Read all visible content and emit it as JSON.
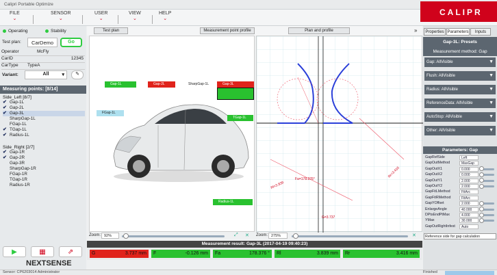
{
  "window": {
    "title": "Calipri Portable Optimize"
  },
  "menu": {
    "items": [
      "FILE",
      "SENSOR",
      "USER",
      "VIEW",
      "HELP"
    ]
  },
  "brand": {
    "name": "CALIPR"
  },
  "status": {
    "operating": "Operating",
    "stability": "Stability"
  },
  "testplan": {
    "label": "Test plan:",
    "value": "CarDemo",
    "button": "Go"
  },
  "fields": [
    {
      "label": "Operator",
      "value": "McFly"
    },
    {
      "label": "CarID",
      "value": "12345"
    },
    {
      "label": "CarType",
      "value": "TypeA"
    }
  ],
  "variant": {
    "label": "Variant:",
    "value": "All"
  },
  "measuring_points": {
    "title": "Measuring points: [8/14]"
  },
  "tree": {
    "side_left": {
      "label": "Side_Left [8/7]",
      "items": [
        {
          "label": "Gap-1L",
          "checked": true
        },
        {
          "label": "Gap-2L",
          "checked": true
        },
        {
          "label": "Gap-3L",
          "checked": true
        },
        {
          "label": "SharpGap-1L",
          "checked": false
        },
        {
          "label": "FGap-1L",
          "checked": false
        },
        {
          "label": "TGap-1L",
          "checked": true
        },
        {
          "label": "Radius-1L",
          "checked": true
        }
      ]
    },
    "side_right": {
      "label": "Side_Right [2/7]",
      "items": [
        {
          "label": "Gap-1R",
          "checked": true
        },
        {
          "label": "Gap-2R",
          "checked": true
        },
        {
          "label": "Gap-3R",
          "checked": false
        },
        {
          "label": "SharpGap-1R",
          "checked": false
        },
        {
          "label": "FGap-1R",
          "checked": false
        },
        {
          "label": "TGap-1R",
          "checked": false
        },
        {
          "label": "Radius-1R",
          "checked": false
        }
      ]
    }
  },
  "footer_brand": "NEXTSENSE",
  "center_tabs": {
    "test_plan": "Test plan",
    "mpp": "Measurement point profile",
    "plan_profile": "Plan and profile"
  },
  "zoom": {
    "label": "Zoom:",
    "left_value": "92%",
    "right_value": "275%"
  },
  "result": {
    "title": "Measurement result: Gap-3L (2017-04-19 09:40:23)",
    "values": [
      {
        "key": "G",
        "value": "3.737 mm",
        "color": "#e0231b"
      },
      {
        "key": "F",
        "value": "-0.126 mm",
        "color": "#29c12f"
      },
      {
        "key": "Fa",
        "value": "178.376 °",
        "color": "#29c12f"
      },
      {
        "key": "Rl",
        "value": "3.839 mm",
        "color": "#29c12f"
      },
      {
        "key": "Rr",
        "value": "3.416 mm",
        "color": "#29c12f"
      }
    ]
  },
  "car_flags": [
    {
      "label": "Gap-1L",
      "color": "#29c12f"
    },
    {
      "label": "Gap-2L",
      "color": "#e0231b"
    },
    {
      "label": "SharpGap-1L",
      "color": "#ffffff"
    },
    {
      "label": "Gap-3L",
      "color": "#e0231b"
    },
    {
      "label": "FGap-1L",
      "color": "#aee0ef"
    },
    {
      "label": "TGap-1L",
      "color": "#29c12f"
    },
    {
      "label": "Radius-1L",
      "color": "#29c12f"
    }
  ],
  "profile_labels": {
    "fa": "Fa=178.376°",
    "gap": "G=3.737",
    "rl": "Rl=3.839",
    "rr": "Rr=3.416"
  },
  "right": {
    "tabs": [
      "Properties",
      "Parameters",
      "Inputs"
    ],
    "preset_title": "Gap-3L: Presets",
    "method": "Measurement method: Gap",
    "dropdowns": [
      "Gap: AllVisible",
      "Flush: AllVisible",
      "Radius: AllVisible",
      "ReferenceData: AllVisible",
      "AutoStop: AllVisible",
      "Other: AllVisible"
    ],
    "params_title": "Parameters: Gap",
    "params": [
      {
        "k": "GapRefSide",
        "v": "Left"
      },
      {
        "k": "GapOutMethod",
        "v": "MaxGap"
      },
      {
        "k": "GapOutX1",
        "v": "0.000"
      },
      {
        "k": "GapOutX2",
        "v": "0.000"
      },
      {
        "k": "GapOutY1",
        "v": "2.000"
      },
      {
        "k": "GapOutY2",
        "v": "2.000"
      },
      {
        "k": "GapFitLMethod",
        "v": "FitArc"
      },
      {
        "k": "GapFitRMethod",
        "v": "FitArc"
      },
      {
        "k": "GapYOffset",
        "v": "2.000"
      },
      {
        "k": "EnlargeAngle",
        "v": "40.000"
      },
      {
        "k": "DPtsEndPtMax",
        "v": "4.000"
      },
      {
        "k": "YMax",
        "v": "30.000"
      },
      {
        "k": "GapOutRightInfest",
        "v": "Auto"
      }
    ],
    "tip": "Reference side for gap calculation"
  },
  "statusbar": {
    "left": "Sensor: CP6203014 Administrator",
    "right": "Finished"
  }
}
